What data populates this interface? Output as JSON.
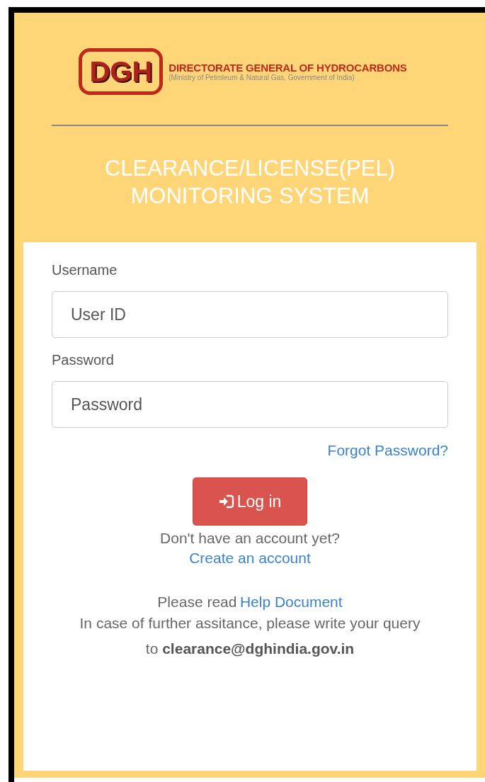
{
  "logo": {
    "mark": "DGH",
    "name": "DIRECTORATE GENERAL OF HYDROCARBONS",
    "subtitle": "(Ministry of Petroleum & Natural Gas, Government of India)"
  },
  "title_lines": [
    "CLEARANCE/LICENSE(PEL)",
    "MONITORING SYSTEM"
  ],
  "form": {
    "fields": [
      {
        "label": "Username",
        "placeholder": "User ID"
      },
      {
        "label": "Password",
        "placeholder": "Password"
      }
    ],
    "forgot_link": "Forgot Password?",
    "login_button": "Log in",
    "signup_prompt": "Don't have an account yet?",
    "signup_link": "Create an account"
  },
  "help": {
    "prefix": "Please read",
    "link": "Help Document",
    "contact": "In case of further assitance, please write your query to **clearance@dghindia.gov.in**"
  }
}
